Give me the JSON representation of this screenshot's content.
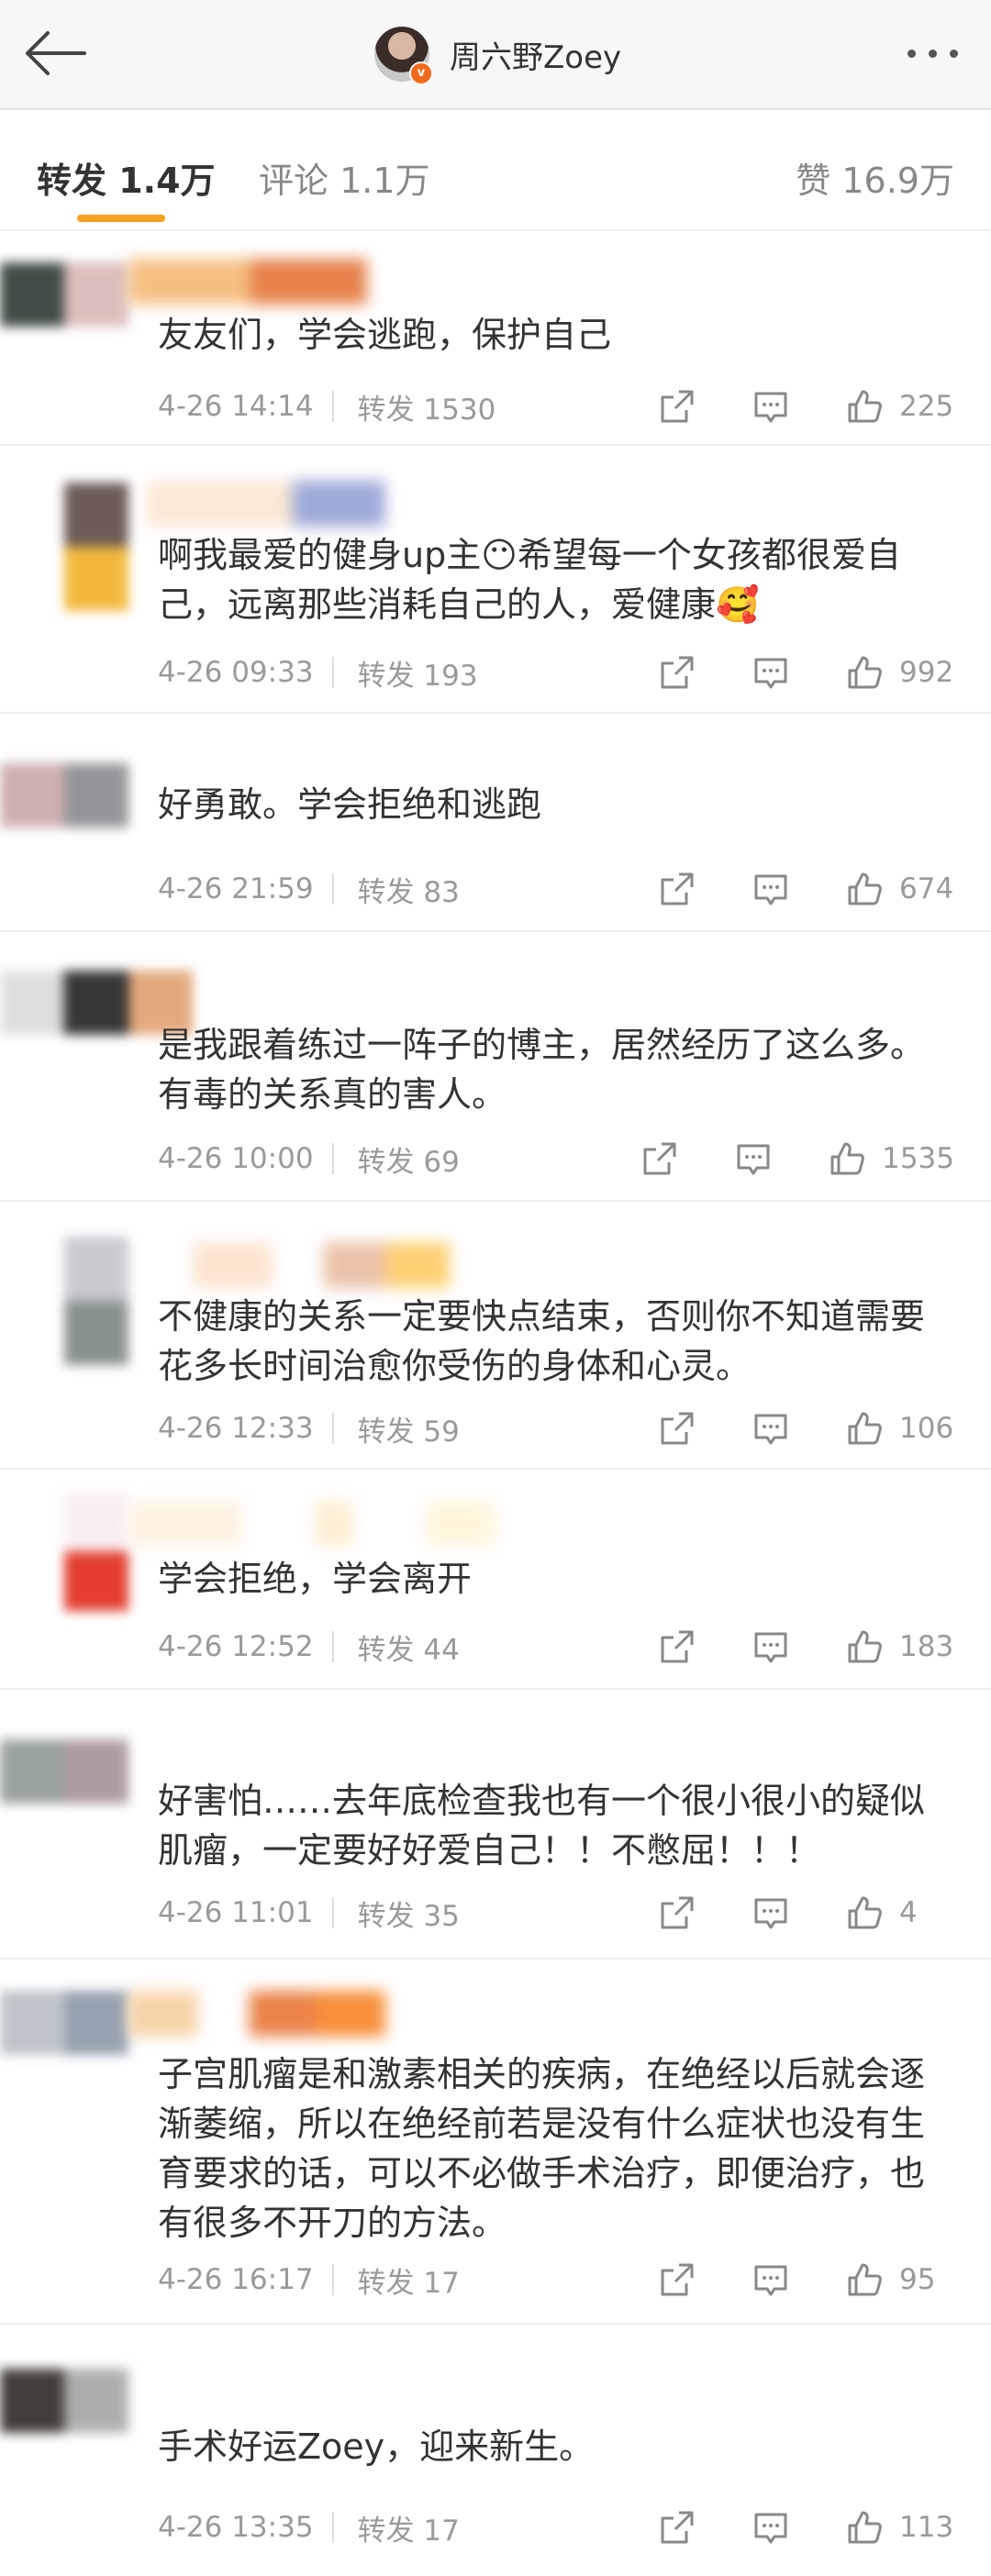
{
  "header": {
    "title": "周六野Zoey",
    "badge": "v"
  },
  "tabs": {
    "repost": "转发 1.4万",
    "comments": "评论 1.1万",
    "likes": "赞 16.9万"
  },
  "comments": [
    {
      "text": "友友们，学会逃跑，保护自己",
      "time": "4-26 14:14",
      "repost": "转发 1530",
      "likes": "225"
    },
    {
      "text": "啊我最爱的健身up主😶希望每一个女孩都很爱自己，远离那些消耗自己的人，爱健康🥰",
      "time": "4-26 09:33",
      "repost": "转发 193",
      "likes": "992"
    },
    {
      "text": "好勇敢。学会拒绝和逃跑",
      "time": "4-26 21:59",
      "repost": "转发 83",
      "likes": "674"
    },
    {
      "text": "是我跟着练过一阵子的博主，居然经历了这么多。有毒的关系真的害人。",
      "time": "4-26 10:00",
      "repost": "转发 69",
      "likes": "1535"
    },
    {
      "text": "不健康的关系一定要快点结束，否则你不知道需要花多长时间治愈你受伤的身体和心灵。",
      "time": "4-26 12:33",
      "repost": "转发 59",
      "likes": "106"
    },
    {
      "text": "学会拒绝，学会离开",
      "time": "4-26 12:52",
      "repost": "转发 44",
      "likes": "183"
    },
    {
      "text": "好害怕……去年底检查我也有一个很小很小的疑似肌瘤，一定要好好爱自己！！不憋屈！！！",
      "time": "4-26 11:01",
      "repost": "转发 35",
      "likes": "4"
    },
    {
      "text": "子宫肌瘤是和激素相关的疾病，在绝经以后就会逐渐萎缩，所以在绝经前若是没有什么症状也没有生育要求的话，可以不必做手术治疗，即便治疗，也有很多不开刀的方法。",
      "time": "4-26 16:17",
      "repost": "转发 17",
      "likes": "95"
    },
    {
      "text": "手术好运Zoey，迎来新生。",
      "time": "4-26 13:35",
      "repost": "转发 17",
      "likes": "113"
    }
  ],
  "colors": {
    "accent": "#f6a020",
    "meta_text": "#9a9a9a",
    "body_text": "#333333"
  },
  "icons": [
    "back-arrow-icon",
    "more-icon",
    "repost-icon",
    "comment-icon",
    "like-icon"
  ]
}
